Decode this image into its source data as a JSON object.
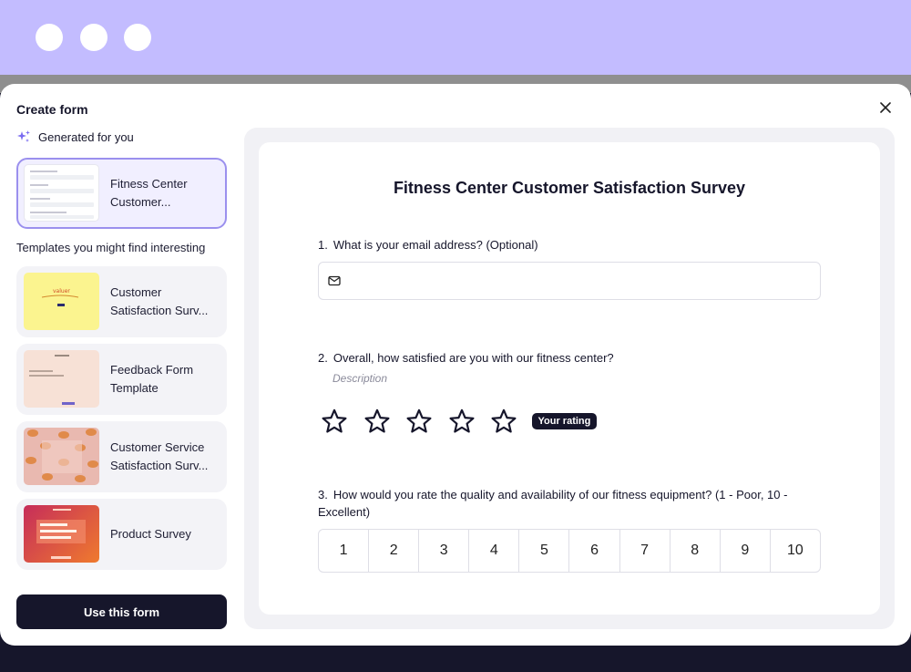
{
  "modal": {
    "title": "Create form",
    "generated_header": "Generated for you",
    "generated_item": {
      "label": "Fitness Center Customer..."
    },
    "templates_header": "Templates you might find interesting",
    "templates": [
      {
        "label": "Customer Satisfaction Surv...",
        "thumb_color": "#fbf48f"
      },
      {
        "label": "Feedback Form Template",
        "thumb_color": "#f7e1d6"
      },
      {
        "label": "Customer Service Satisfaction Surv...",
        "thumb_color": "#e9b9b0"
      },
      {
        "label": "Product Survey",
        "thumb_color": "#e8533f"
      }
    ],
    "use_button": "Use this form"
  },
  "preview": {
    "title": "Fitness Center Customer Satisfaction Survey",
    "questions": [
      {
        "number": "1.",
        "text": "What is your email address? (Optional)",
        "input_icon": "mail-icon"
      },
      {
        "number": "2.",
        "text": "Overall, how satisfied are you with our fitness center?",
        "description": "Description",
        "stars": 5,
        "badge": "Your rating"
      },
      {
        "number": "3.",
        "text": "How would you rate the quality and availability of our fitness equipment? (1 - Poor, 10 - Excellent)",
        "scale": [
          "1",
          "2",
          "3",
          "4",
          "5",
          "6",
          "7",
          "8",
          "9",
          "10"
        ]
      }
    ]
  },
  "colors": {
    "topbar": "#c3bcff",
    "accent": "#9b90ee",
    "dark": "#16162b"
  }
}
